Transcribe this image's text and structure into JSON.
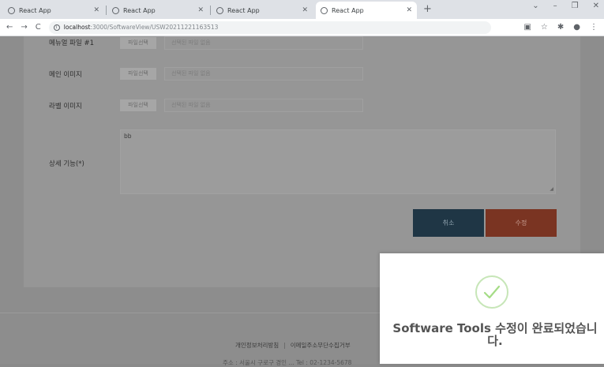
{
  "browser": {
    "tabs": [
      {
        "title": "React App",
        "active": false
      },
      {
        "title": "React App",
        "active": false
      },
      {
        "title": "React App",
        "active": false
      },
      {
        "title": "React App",
        "active": true
      }
    ],
    "close_glyph": "✕",
    "new_tab_glyph": "+",
    "window_controls": [
      "⌄",
      "–",
      "❐",
      "✕"
    ],
    "nav": {
      "back": "←",
      "forward": "→",
      "reload": "C"
    },
    "url_host": "localhost",
    "url_path": ":3000/SoftwareView/USW20211221163513",
    "toolbar_icons": [
      "▣",
      "☆",
      "✱",
      "●",
      "⋮"
    ]
  },
  "form": {
    "rows": [
      {
        "label": "메뉴얼 파일 #1",
        "button": "파일선택",
        "value": "선택된 파일 없음"
      },
      {
        "label": "메인 이미지",
        "button": "파일선택",
        "value": "선택된 파일 없음"
      },
      {
        "label": "라벨 이미지",
        "button": "파일선택",
        "value": "선택된 파일 없음"
      }
    ],
    "detail_label": "상세 기능(*)",
    "detail_value": "bb",
    "cancel_label": "취소",
    "submit_label": "수정"
  },
  "footer": {
    "links": [
      "개인정보처리방침",
      "이메일주소무단수집거부"
    ],
    "separator": "|",
    "address": "주소 : 서울시 구로구 경인 ... Tel : 02-1234-5678"
  },
  "toast": {
    "message": "Software Tools 수정이 완료되었습니다."
  },
  "colors": {
    "accent_success": "#a5dc86",
    "cancel_bg": "#1f3645",
    "submit_bg": "#7a3422"
  }
}
